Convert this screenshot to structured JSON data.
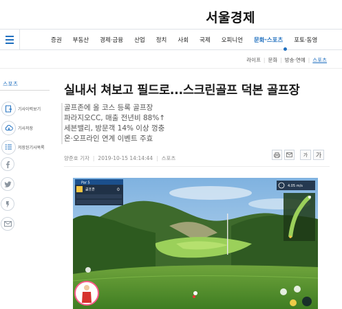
{
  "masthead": {
    "logo": "서울경제"
  },
  "nav": {
    "items": [
      "증권",
      "부동산",
      "경제·금융",
      "산업",
      "정치",
      "사회",
      "국제",
      "오피니언",
      "문화·스포츠",
      "포토·동영"
    ],
    "active_index": 8
  },
  "subnav": {
    "items": [
      "라이프",
      "문화",
      "방송·연예",
      "스포츠"
    ],
    "active_index": 3
  },
  "section": {
    "label": "스포츠"
  },
  "side_tools": [
    {
      "icon": "recent-articles-icon",
      "label": "기사이력보기"
    },
    {
      "icon": "cloud-save-icon",
      "label": "기사저장"
    },
    {
      "icon": "saved-list-icon",
      "label": "저장된기사목록"
    }
  ],
  "share_icons": [
    "facebook-icon",
    "twitter-icon",
    "kakaostory-icon",
    "mail-icon"
  ],
  "article": {
    "headline": "실내서 쳐보고 필드로...스크린골프 덕본 골프장",
    "summary": [
      "골프존에 올 코스 등록 골프장",
      "파라지오CC, 매출 전년비 88%↑",
      "세븐밸리, 방문객 14% 이상 껑충",
      "온·오프라인 연계 이벤트 주효"
    ],
    "byline": {
      "reporter": "양준호 기자",
      "datetime": "2019-10-15 14:14:44",
      "section": "스포츠"
    },
    "tools": {
      "font_small": "가",
      "font_large": "가"
    }
  },
  "photo_hud": {
    "hole_label": "Par 5",
    "distance": "4.05 m/s",
    "player_row": "골프존",
    "score": "0"
  },
  "colors": {
    "accent": "#1f6fbf",
    "sky": "#9cc4e6",
    "fairway": "#7fb24a",
    "forest": "#3e6a2c"
  }
}
